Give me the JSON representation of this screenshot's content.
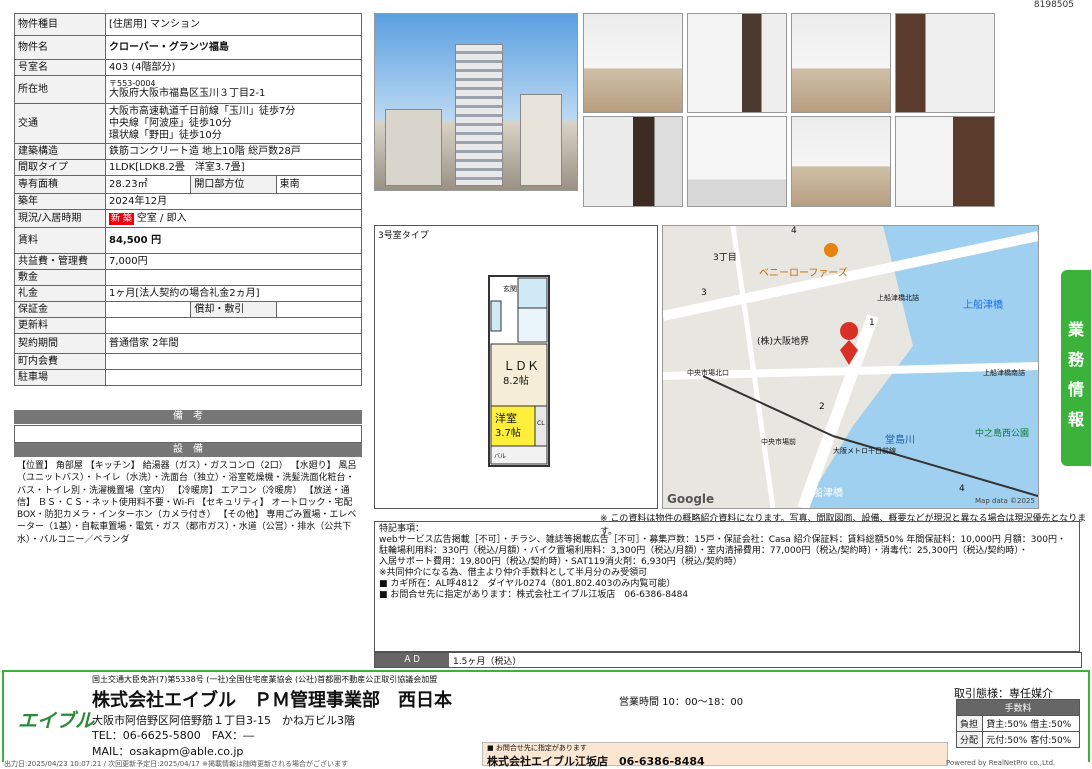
{
  "doc_id": "8198505",
  "property": {
    "type_label": "物件種目",
    "type_value": "[住居用] マンション",
    "name_label": "物件名",
    "name_value": "クローバー・グランツ福島",
    "room_label": "号室名",
    "room_value": "403 (4階部分)",
    "addr_label": "所在地",
    "postal": "〒553-0004",
    "address": "大阪府大阪市福島区玉川３丁目2-1",
    "transit_label": "交通",
    "transit": [
      "大阪市高速軌道千日前線「玉川」徒歩7分",
      "中央線「阿波座」徒歩10分",
      "環状線「野田」徒歩10分"
    ],
    "structure_label": "建築構造",
    "structure_value": "鉄筋コンクリート造 地上10階 総戸数28戸",
    "layout_label": "間取タイプ",
    "layout_value": "1LDK[LDK8.2畳　洋室3.7畳]",
    "area_label": "専有面積",
    "area_value": "28.23㎡",
    "direction_label": "開口部方位",
    "direction_value": "東南",
    "built_label": "築年",
    "built_value": "2024年12月",
    "status_label": "現況/入居時期",
    "new_badge": "新 築",
    "status_value": "空室 / 即入",
    "rent_label": "賃料",
    "rent_value": "84,500 円",
    "fee_label": "共益費・管理費",
    "fee_value": "7,000円",
    "deposit_label": "敷金",
    "deposit_value": "",
    "key_label": "礼金",
    "key_value": "1ヶ月[法人契約の場合礼金2ヵ月]",
    "guarantee_label": "保証金",
    "guarantee_value": "",
    "amort_label": "償却・敷引",
    "amort_value": "",
    "renewal_label": "更新料",
    "renewal_value": "",
    "contract_label": "契約期間",
    "contract_value": "普通借家 2年間",
    "assoc_label": "町内会費",
    "assoc_value": "",
    "parking_label": "駐車場",
    "parking_value": ""
  },
  "remarks_header": "備　考",
  "equipment_header": "設　備",
  "equipment_text": "【位置】 角部屋 【キッチン】 給湯器（ガス）・ガスコンロ（2口） 【水廻り】 風呂（ユニットバス）・トイレ（水洗）・洗面台（独立）・浴室乾燥機・洗髪洗面化粧台・バス・トイレ別・洗濯機置場（室内） 【冷暖房】 エアコン（冷暖房） 【放送・通信】 ＢＳ・ＣＳ・ネット使用料不要・Wi-Fi 【セキュリティ】 オートロック・宅配BOX・防犯カメラ・インターホン（カメラ付き） 【その他】 専用ごみ置場・エレベーター（1基）・自転車置場・電気・ガス（都市ガス）・水道（公営）・排水（公共下水）・バルコニー／ベランダ",
  "floorplan": {
    "caption": "3号室タイプ",
    "ldk": "ＬＤＫ",
    "ldk_size": "8.2帖",
    "western": "洋室",
    "western_size": "3.7帖",
    "genkan": "玄関",
    "cl": "CL",
    "balcony": "バル"
  },
  "map": {
    "labels": [
      "3丁目",
      "ベニーローファーズ",
      "上船津橋北詰",
      "上船津橋",
      "(株)大阪地界",
      "中央市場北口",
      "上船津橋南詰",
      "中央市場前",
      "大阪メトロ千日前線",
      "中之島西公園",
      "堂島川",
      "船津橋"
    ],
    "nums": [
      "4",
      "3",
      "1",
      "2",
      "4"
    ],
    "google": "Google",
    "copyright": "Map data ©2025"
  },
  "notice": "※ この資料は物件の概略紹介資料になります。写真、間取図面、設備、概要などが現況と異なる場合は現況優先となります。",
  "remarks": {
    "title": "特記事項：",
    "lines": [
      "webサービス広告掲載［不可］・チラシ、雑誌等掲載広告［不可］・募集戸数：15戸・保証会社：Casa 紹介保証料：賃料総額50% 年間保証料：10,000円 月額：300円・",
      "駐輪場利用料：330円（税込/月額）・バイク置場利用料：3,300円（税込/月額）・室内清掃費用：77,000円（税込/契約時）・消毒代：25,300円（税込/契約時）・",
      "入居サポート費用：19,800円（税込/契約時）・SAT119消火剤：6,930円（税込/契約時）",
      "※共同仲介になる為、借主より仲介手数料として半月分のみ受領可",
      "■ カギ所在：AL呼4812　ダイヤル0274（801.802.403のみ内覧可能）",
      "■ お問合せ先に指定があります：株式会社エイブル江坂店　06-6386-8484"
    ]
  },
  "ad": {
    "label": "ＡＤ",
    "value": "1.5ヶ月（税込）"
  },
  "sidetab": [
    "業",
    "務",
    "情",
    "報"
  ],
  "footer": {
    "license": "国土交通大臣免許(7)第5338号 (一社)全国住宅産業協会 (公社)首都圏不動産公正取引協議会加盟",
    "logo": "エイブル",
    "company": "株式会社エイブル　ＰＭ管理事業部　西日本",
    "address": "大阪市阿倍野区阿倍野筋１丁目3-15　かね万ビル3階",
    "tel": "TEL：06-6625-5800　FAX：―",
    "mail": "MAIL：osakapm@able.co.jp",
    "hours": "営業時間 10：00～18：00",
    "contact_note": "■ お問合せ先に指定があります",
    "contact": "株式会社エイブル江坂店　06-6386-8484",
    "deal_type": "取引態様：専任媒介",
    "fee_title": "手数料",
    "fee_rows": [
      {
        "k": "負担",
        "v": "貸主:50% 借主:50%"
      },
      {
        "k": "分配",
        "v": "元付:50% 客付:50%"
      }
    ],
    "bottom_left": "出力日:2025/04/23 10:07:21 / 次回更新予定日:2025/04/17 ※掲載情報は随時更新される場合がございます",
    "powered": "Powered by RealNetPro co.,Ltd."
  }
}
